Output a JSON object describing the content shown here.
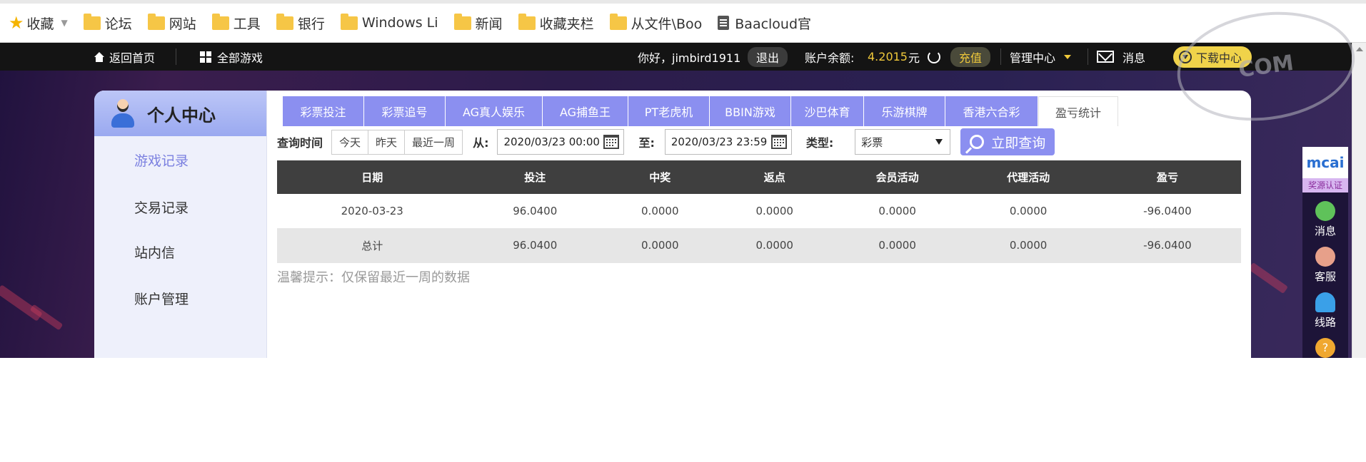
{
  "bookmarks": {
    "favorites": "收藏",
    "folders": [
      "论坛",
      "网站",
      "工具",
      "银行",
      "Windows Li",
      "新闻",
      "收藏夹栏",
      "从文件\\Boo"
    ],
    "page_link": "Baacloud官"
  },
  "topnav": {
    "home": "返回首页",
    "all_games": "全部游戏",
    "greeting": "你好，jimbird1911",
    "logout": "退出",
    "balance_label": "账户余额:",
    "balance_value": "4.2015",
    "currency": "元",
    "recharge": "充值",
    "manage": "管理中心",
    "messages": "消息",
    "download": "下载中心"
  },
  "sidebar": {
    "title": "个人中心",
    "items": [
      "游戏记录",
      "交易记录",
      "站内信",
      "账户管理"
    ]
  },
  "tabs": [
    "彩票投注",
    "彩票追号",
    "AG真人娱乐",
    "AG捕鱼王",
    "PT老虎机",
    "BBIN游戏",
    "沙巴体育",
    "乐游棋牌",
    "香港六合彩",
    "盈亏统计"
  ],
  "filter": {
    "query_time_label": "查询时间",
    "quick_ranges": [
      "今天",
      "昨天",
      "最近一周"
    ],
    "from_label": "从:",
    "from_value": "2020/03/23 00:00",
    "to_label": "至:",
    "to_value": "2020/03/23 23:59",
    "type_label": "类型:",
    "type_value": "彩票",
    "query_button": "立即查询"
  },
  "table": {
    "headers": [
      "日期",
      "投注",
      "中奖",
      "返点",
      "会员活动",
      "代理活动",
      "盈亏"
    ],
    "rows": [
      [
        "2020-03-23",
        "96.0400",
        "0.0000",
        "0.0000",
        "0.0000",
        "0.0000",
        "-96.0400"
      ]
    ],
    "total": [
      "总计",
      "96.0400",
      "0.0000",
      "0.0000",
      "0.0000",
      "0.0000",
      "-96.0400"
    ]
  },
  "tip": "温馨提示：仅保留最近一周的数据",
  "floatbar": {
    "brand": "mcai",
    "brand_tag": "奖源认证",
    "items": [
      "消息",
      "客服",
      "线路"
    ],
    "help": "?"
  },
  "watermark": "COM",
  "colors": {
    "accent": "#8b8ff0",
    "gold": "#f0c93a",
    "header_dark": "#3f3f3f"
  }
}
